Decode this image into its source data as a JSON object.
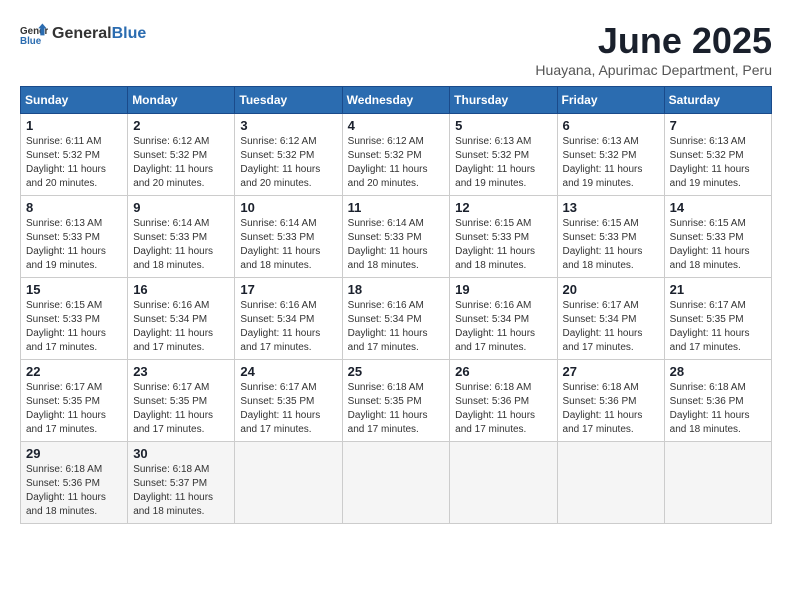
{
  "logo": {
    "general": "General",
    "blue": "Blue"
  },
  "header": {
    "month": "June 2025",
    "location": "Huayana, Apurimac Department, Peru"
  },
  "days_of_week": [
    "Sunday",
    "Monday",
    "Tuesday",
    "Wednesday",
    "Thursday",
    "Friday",
    "Saturday"
  ],
  "weeks": [
    [
      {
        "day": "1",
        "sunrise": "6:11 AM",
        "sunset": "5:32 PM",
        "daylight": "11 hours and 20 minutes."
      },
      {
        "day": "2",
        "sunrise": "6:12 AM",
        "sunset": "5:32 PM",
        "daylight": "11 hours and 20 minutes."
      },
      {
        "day": "3",
        "sunrise": "6:12 AM",
        "sunset": "5:32 PM",
        "daylight": "11 hours and 20 minutes."
      },
      {
        "day": "4",
        "sunrise": "6:12 AM",
        "sunset": "5:32 PM",
        "daylight": "11 hours and 20 minutes."
      },
      {
        "day": "5",
        "sunrise": "6:13 AM",
        "sunset": "5:32 PM",
        "daylight": "11 hours and 19 minutes."
      },
      {
        "day": "6",
        "sunrise": "6:13 AM",
        "sunset": "5:32 PM",
        "daylight": "11 hours and 19 minutes."
      },
      {
        "day": "7",
        "sunrise": "6:13 AM",
        "sunset": "5:32 PM",
        "daylight": "11 hours and 19 minutes."
      }
    ],
    [
      {
        "day": "8",
        "sunrise": "6:13 AM",
        "sunset": "5:33 PM",
        "daylight": "11 hours and 19 minutes."
      },
      {
        "day": "9",
        "sunrise": "6:14 AM",
        "sunset": "5:33 PM",
        "daylight": "11 hours and 18 minutes."
      },
      {
        "day": "10",
        "sunrise": "6:14 AM",
        "sunset": "5:33 PM",
        "daylight": "11 hours and 18 minutes."
      },
      {
        "day": "11",
        "sunrise": "6:14 AM",
        "sunset": "5:33 PM",
        "daylight": "11 hours and 18 minutes."
      },
      {
        "day": "12",
        "sunrise": "6:15 AM",
        "sunset": "5:33 PM",
        "daylight": "11 hours and 18 minutes."
      },
      {
        "day": "13",
        "sunrise": "6:15 AM",
        "sunset": "5:33 PM",
        "daylight": "11 hours and 18 minutes."
      },
      {
        "day": "14",
        "sunrise": "6:15 AM",
        "sunset": "5:33 PM",
        "daylight": "11 hours and 18 minutes."
      }
    ],
    [
      {
        "day": "15",
        "sunrise": "6:15 AM",
        "sunset": "5:33 PM",
        "daylight": "11 hours and 17 minutes."
      },
      {
        "day": "16",
        "sunrise": "6:16 AM",
        "sunset": "5:34 PM",
        "daylight": "11 hours and 17 minutes."
      },
      {
        "day": "17",
        "sunrise": "6:16 AM",
        "sunset": "5:34 PM",
        "daylight": "11 hours and 17 minutes."
      },
      {
        "day": "18",
        "sunrise": "6:16 AM",
        "sunset": "5:34 PM",
        "daylight": "11 hours and 17 minutes."
      },
      {
        "day": "19",
        "sunrise": "6:16 AM",
        "sunset": "5:34 PM",
        "daylight": "11 hours and 17 minutes."
      },
      {
        "day": "20",
        "sunrise": "6:17 AM",
        "sunset": "5:34 PM",
        "daylight": "11 hours and 17 minutes."
      },
      {
        "day": "21",
        "sunrise": "6:17 AM",
        "sunset": "5:35 PM",
        "daylight": "11 hours and 17 minutes."
      }
    ],
    [
      {
        "day": "22",
        "sunrise": "6:17 AM",
        "sunset": "5:35 PM",
        "daylight": "11 hours and 17 minutes."
      },
      {
        "day": "23",
        "sunrise": "6:17 AM",
        "sunset": "5:35 PM",
        "daylight": "11 hours and 17 minutes."
      },
      {
        "day": "24",
        "sunrise": "6:17 AM",
        "sunset": "5:35 PM",
        "daylight": "11 hours and 17 minutes."
      },
      {
        "day": "25",
        "sunrise": "6:18 AM",
        "sunset": "5:35 PM",
        "daylight": "11 hours and 17 minutes."
      },
      {
        "day": "26",
        "sunrise": "6:18 AM",
        "sunset": "5:36 PM",
        "daylight": "11 hours and 17 minutes."
      },
      {
        "day": "27",
        "sunrise": "6:18 AM",
        "sunset": "5:36 PM",
        "daylight": "11 hours and 17 minutes."
      },
      {
        "day": "28",
        "sunrise": "6:18 AM",
        "sunset": "5:36 PM",
        "daylight": "11 hours and 18 minutes."
      }
    ],
    [
      {
        "day": "29",
        "sunrise": "6:18 AM",
        "sunset": "5:36 PM",
        "daylight": "11 hours and 18 minutes."
      },
      {
        "day": "30",
        "sunrise": "6:18 AM",
        "sunset": "5:37 PM",
        "daylight": "11 hours and 18 minutes."
      },
      null,
      null,
      null,
      null,
      null
    ]
  ],
  "labels": {
    "sunrise": "Sunrise:",
    "sunset": "Sunset:",
    "daylight": "Daylight:"
  }
}
